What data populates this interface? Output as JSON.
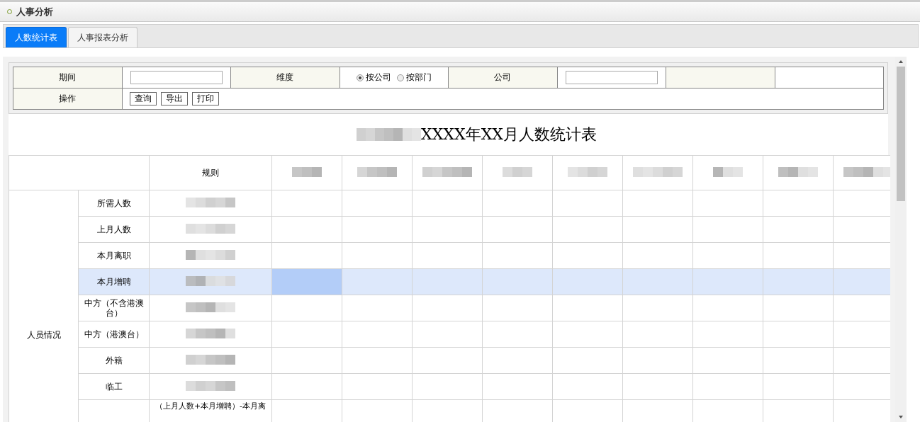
{
  "header": {
    "title": "人事分析"
  },
  "tabs": [
    {
      "label": "人数统计表",
      "selected": true
    },
    {
      "label": "人事报表分析",
      "selected": false
    }
  ],
  "filters": {
    "period_label": "期间",
    "dimension_label": "维度",
    "dimension_options": [
      {
        "label": "按公司",
        "selected": true
      },
      {
        "label": "按部门",
        "selected": false
      }
    ],
    "company_label": "公司",
    "actions_label": "操作",
    "buttons": [
      "查询",
      "导出",
      "打印"
    ]
  },
  "report": {
    "title": "XXXX年XX月人数统计表",
    "title_redacted": true,
    "rule_header": "规则",
    "columns": [
      {
        "kind": "redacted"
      },
      {
        "kind": "redacted"
      },
      {
        "kind": "redacted"
      },
      {
        "kind": "redacted"
      },
      {
        "kind": "redacted"
      },
      {
        "kind": "redacted"
      },
      {
        "kind": "redacted"
      },
      {
        "kind": "redacted"
      },
      {
        "kind": "redacted"
      }
    ],
    "group": "人员情况",
    "rows": [
      {
        "label": "所需人数",
        "selected": false,
        "rule": {
          "kind": "redacted"
        },
        "cells": [
          {
            "selected": false
          },
          {
            "selected": false
          },
          {
            "selected": false
          },
          {
            "selected": false
          },
          {
            "selected": false
          },
          {
            "selected": false
          },
          {
            "selected": false
          },
          {
            "selected": false
          },
          {
            "selected": false
          }
        ]
      },
      {
        "label": "上月人数",
        "selected": false,
        "rule": {
          "kind": "redacted"
        },
        "cells": [
          {
            "selected": false
          },
          {
            "selected": false
          },
          {
            "selected": false
          },
          {
            "selected": false
          },
          {
            "selected": false
          },
          {
            "selected": false
          },
          {
            "selected": false
          },
          {
            "selected": false
          },
          {
            "selected": false
          }
        ]
      },
      {
        "label": "本月离职",
        "selected": false,
        "rule": {
          "kind": "redacted"
        },
        "cells": [
          {
            "selected": false
          },
          {
            "selected": false
          },
          {
            "selected": false
          },
          {
            "selected": false
          },
          {
            "selected": false
          },
          {
            "selected": false
          },
          {
            "selected": false
          },
          {
            "selected": false
          },
          {
            "selected": false
          }
        ]
      },
      {
        "label": "本月增聘",
        "selected": true,
        "rule": {
          "kind": "redacted"
        },
        "cells": [
          {
            "selected": true
          },
          {
            "selected": false
          },
          {
            "selected": false
          },
          {
            "selected": false
          },
          {
            "selected": false
          },
          {
            "selected": false
          },
          {
            "selected": false
          },
          {
            "selected": false
          },
          {
            "selected": false
          }
        ]
      },
      {
        "label": "中方（不含港澳台）",
        "selected": false,
        "rule": {
          "kind": "redacted"
        },
        "cells": [
          {
            "selected": false
          },
          {
            "selected": false
          },
          {
            "selected": false
          },
          {
            "selected": false
          },
          {
            "selected": false
          },
          {
            "selected": false
          },
          {
            "selected": false
          },
          {
            "selected": false
          },
          {
            "selected": false
          }
        ]
      },
      {
        "label": "中方（港澳台）",
        "selected": false,
        "rule": {
          "kind": "redacted"
        },
        "cells": [
          {
            "selected": false
          },
          {
            "selected": false
          },
          {
            "selected": false
          },
          {
            "selected": false
          },
          {
            "selected": false
          },
          {
            "selected": false
          },
          {
            "selected": false
          },
          {
            "selected": false
          },
          {
            "selected": false
          }
        ]
      },
      {
        "label": "外籍",
        "selected": false,
        "rule": {
          "kind": "redacted"
        },
        "cells": [
          {
            "selected": false
          },
          {
            "selected": false
          },
          {
            "selected": false
          },
          {
            "selected": false
          },
          {
            "selected": false
          },
          {
            "selected": false
          },
          {
            "selected": false
          },
          {
            "selected": false
          },
          {
            "selected": false
          }
        ]
      },
      {
        "label": "临工",
        "selected": false,
        "rule": {
          "kind": "redacted"
        },
        "cells": [
          {
            "selected": false
          },
          {
            "selected": false
          },
          {
            "selected": false
          },
          {
            "selected": false
          },
          {
            "selected": false
          },
          {
            "selected": false
          },
          {
            "selected": false
          },
          {
            "selected": false
          },
          {
            "selected": false
          }
        ]
      },
      {
        "selected": false,
        "rule": {
          "kind": "text",
          "text": "（上月人数+本月增聘）-本月离"
        },
        "cells": [
          {
            "selected": false
          },
          {
            "selected": false
          },
          {
            "selected": false
          },
          {
            "selected": false
          },
          {
            "selected": false
          },
          {
            "selected": false
          },
          {
            "selected": false
          },
          {
            "selected": false
          },
          {
            "selected": false
          }
        ]
      }
    ]
  }
}
